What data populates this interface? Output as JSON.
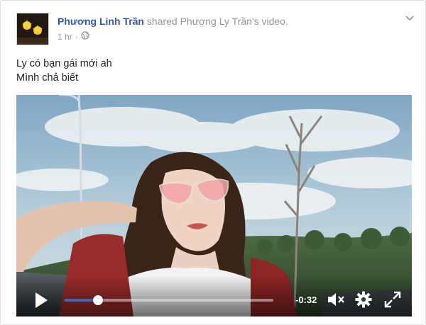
{
  "post": {
    "author": "Phương Linh Trần",
    "shared_text": " shared ",
    "shared_owner": "Phương Ly Trần",
    "shared_suffix": "'s video.",
    "time": "1 hr",
    "time_separator": " · ",
    "privacy_icon": "globe-icon",
    "menu_icon": "chevron-down-icon",
    "text_lines": [
      "Ly có bạn gái mới ah",
      "Mình chả biết"
    ]
  },
  "video": {
    "remaining_time": "-0:32",
    "progress": 0.16,
    "icons": [
      "play-icon",
      "mute-icon",
      "settings-gear-icon",
      "fullscreen-icon"
    ]
  }
}
